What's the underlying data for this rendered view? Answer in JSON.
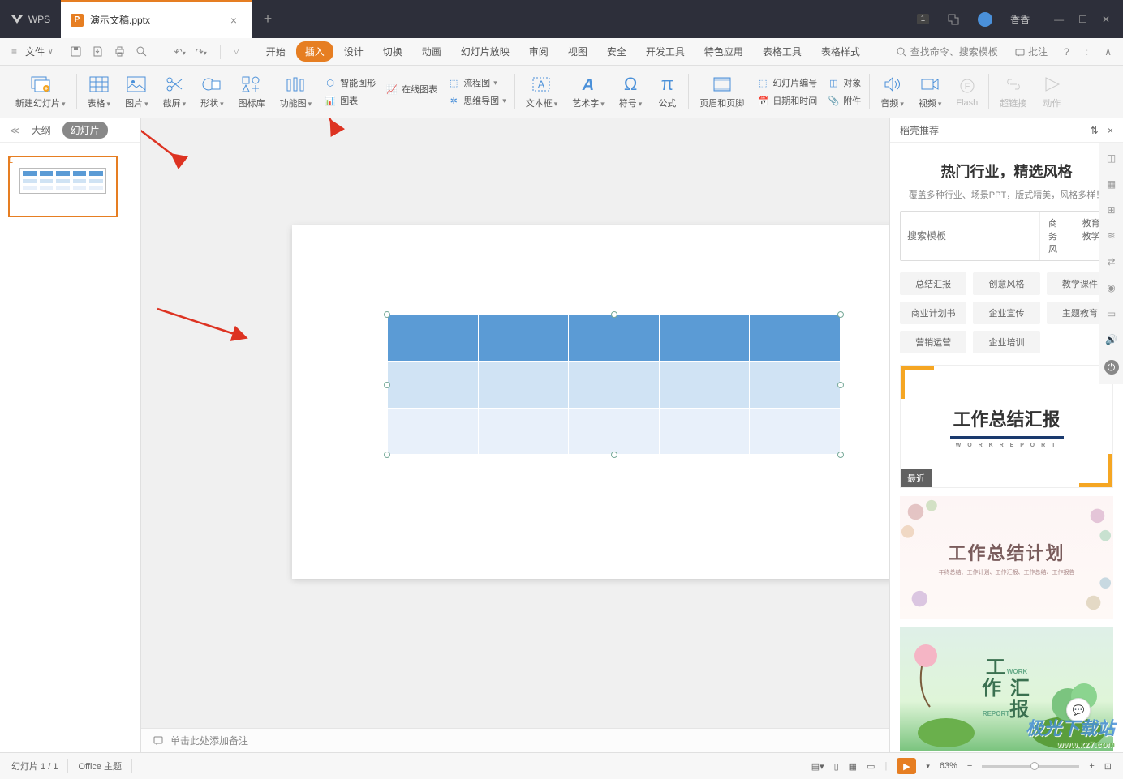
{
  "titlebar": {
    "wps_label": "WPS",
    "file_icon": "P",
    "file_name": "演示文稿.pptx",
    "badge": "1",
    "user_name": "香香"
  },
  "menubar": {
    "file_label": "文件",
    "tabs": [
      "开始",
      "插入",
      "设计",
      "切换",
      "动画",
      "幻灯片放映",
      "审阅",
      "视图",
      "安全",
      "开发工具",
      "特色应用",
      "表格工具",
      "表格样式"
    ],
    "active_tab_index": 1,
    "search_placeholder": "查找命令、搜索模板",
    "annotate": "批注"
  },
  "ribbon": {
    "new_slide": "新建幻灯片",
    "table": "表格",
    "image": "图片",
    "screenshot": "截屏",
    "shape": "形状",
    "icon_lib": "图标库",
    "func_img": "功能图",
    "smart_art": "智能图形",
    "online_chart": "在线图表",
    "chart": "图表",
    "flowchart": "流程图",
    "mindmap": "思维导图",
    "textbox": "文本框",
    "wordart": "艺术字",
    "symbol": "符号",
    "formula": "公式",
    "header_footer": "页眉和页脚",
    "slide_num": "幻灯片编号",
    "datetime": "日期和时间",
    "object": "对象",
    "attachment": "附件",
    "audio": "音频",
    "video": "视频",
    "flash": "Flash",
    "hyperlink": "超链接",
    "action": "动作"
  },
  "left_panel": {
    "outline": "大纲",
    "slides": "幻灯片",
    "slide_number": "1"
  },
  "canvas": {
    "notes_placeholder": "单击此处添加备注"
  },
  "right_panel": {
    "header": "稻壳推荐",
    "title": "热门行业，精选风格",
    "subtitle": "覆盖多种行业、场景PPT，版式精美，风格多样！",
    "search_placeholder": "搜索模板",
    "search_btn1": "商务风",
    "search_btn2": "教育教学",
    "tags": [
      "总结汇报",
      "创意风格",
      "教学课件",
      "商业计划书",
      "企业宣传",
      "主题教育",
      "营销运营",
      "企业培训"
    ],
    "template1_title": "工作总结汇报",
    "template1_letters": "W O R K   R E P O R T",
    "template1_badge": "最近",
    "template2_title": "工作总结计划",
    "template2_sub": "年终总结、工作计划、工作汇报、工作总结、工作报告",
    "template3_line1": "工",
    "template3_line2": "作 汇",
    "template3_line3": "报",
    "template3_work": "WORK",
    "template3_report": "REPORT"
  },
  "statusbar": {
    "slide_info": "幻灯片 1 / 1",
    "theme": "Office 主题",
    "zoom": "63%"
  },
  "watermark": {
    "text": "极光下载站",
    "url": "www.xz7.com"
  }
}
